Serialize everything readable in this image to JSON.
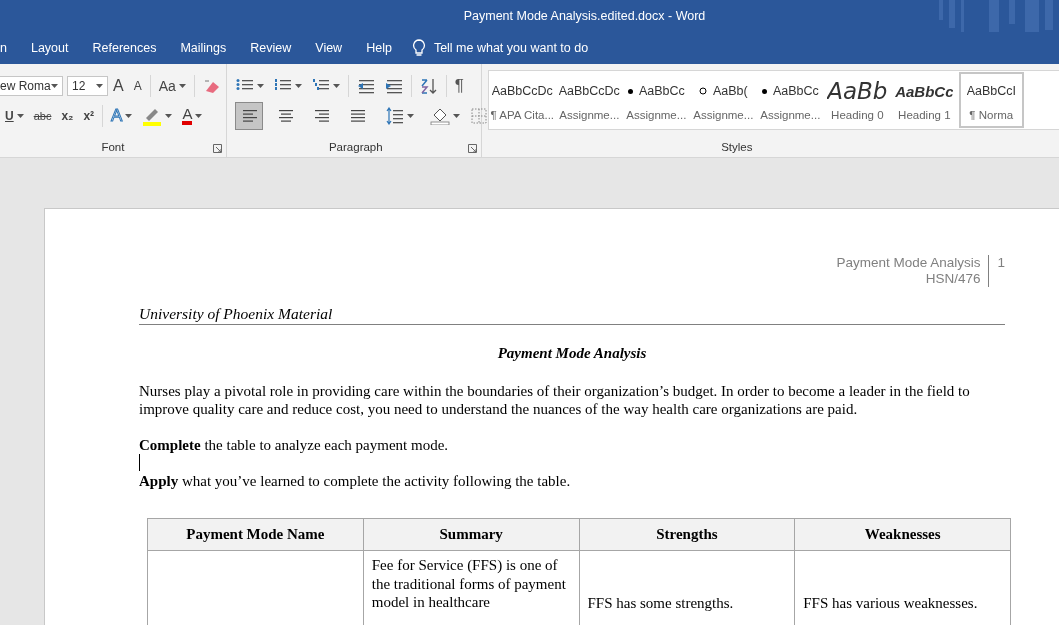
{
  "window": {
    "title": "Payment Mode Analysis.edited.docx  -  Word"
  },
  "tabs": [
    {
      "label": "n"
    },
    {
      "label": "Layout"
    },
    {
      "label": "References"
    },
    {
      "label": "Mailings"
    },
    {
      "label": "Review"
    },
    {
      "label": "View"
    },
    {
      "label": "Help"
    }
  ],
  "tell_me": {
    "placeholder": "Tell me what you want to do"
  },
  "font_group": {
    "label": "Font",
    "font_name": "ew Roma",
    "font_size": "12",
    "row1": [
      {
        "kind": "grow",
        "text": "A"
      },
      {
        "kind": "shrink",
        "text": "A"
      },
      {
        "kind": "case",
        "text": "Aa"
      },
      {
        "kind": "clear"
      }
    ],
    "row2": [
      {
        "kind": "underline",
        "text": "U"
      },
      {
        "kind": "strike",
        "text": "abc"
      },
      {
        "kind": "sub",
        "text": "x₂"
      },
      {
        "kind": "sup",
        "text": "x²"
      },
      {
        "kind": "effects",
        "text": "A"
      },
      {
        "kind": "highlight",
        "color": "#ffff00"
      },
      {
        "kind": "fontcolor",
        "text": "A",
        "color": "#e00000"
      }
    ]
  },
  "paragraph_group": {
    "label": "Paragraph",
    "row1": [
      {
        "kind": "bullets"
      },
      {
        "kind": "numbering"
      },
      {
        "kind": "multilevel"
      },
      {
        "kind": "outdent"
      },
      {
        "kind": "indent"
      },
      {
        "kind": "sort"
      },
      {
        "kind": "marks",
        "text": "¶"
      }
    ],
    "row2": [
      {
        "kind": "align-left",
        "selected": true
      },
      {
        "kind": "align-center",
        "selected": false
      },
      {
        "kind": "align-right",
        "selected": false
      },
      {
        "kind": "justify",
        "selected": false
      },
      {
        "kind": "spacing"
      },
      {
        "kind": "shading"
      },
      {
        "kind": "borders"
      }
    ]
  },
  "styles_group": {
    "label": "Styles",
    "items": [
      {
        "preview": "AaBbCcDc",
        "name": "¶ APA Cita...",
        "kind": "plain",
        "selected": false
      },
      {
        "preview": "AaBbCcDc",
        "name": "Assignme...",
        "kind": "plain",
        "selected": false
      },
      {
        "preview": "AaBbCc",
        "name": "Assignme...",
        "kind": "bullet",
        "selected": false
      },
      {
        "preview": "AaBb(",
        "name": "Assignme...",
        "kind": "circle",
        "selected": false
      },
      {
        "preview": "AaBbCc",
        "name": "Assignme...",
        "kind": "bullet",
        "selected": false
      },
      {
        "preview": "AaBb",
        "name": "Heading 0",
        "kind": "heading0",
        "selected": false
      },
      {
        "preview": "AaBbCc",
        "name": "Heading 1",
        "kind": "heading1",
        "selected": false
      },
      {
        "preview": "AaBbCcI",
        "name": "¶ Norma",
        "kind": "plain",
        "selected": true
      }
    ]
  },
  "document": {
    "header": {
      "title": "Payment Mode Analysis",
      "code": "HSN/476",
      "page": "1"
    },
    "material": "University of Phoenix Material",
    "heading": "Payment Mode Analysis",
    "paragraphs": [
      {
        "kind": "text",
        "text": "Nurses play a pivotal role in providing care within the boundaries of their organization’s budget. In order to become a leader in the field to improve quality care and reduce cost, you need to understand the nuances of the way health care organizations are paid."
      },
      {
        "kind": "text",
        "text": "**Complete** the table to analyze each payment mode."
      },
      {
        "kind": "cursor"
      },
      {
        "kind": "text",
        "text": "**Apply** what you’ve learned to complete the activity following the table."
      }
    ],
    "table": {
      "columns": [
        "Payment Mode Name",
        "Summary",
        "Strengths",
        "Weaknesses"
      ],
      "rows": [
        [
          "",
          "Fee for Service (FFS) is one of the traditional forms of payment model in healthcare",
          "FFS has some strengths.",
          "FFS has various weaknesses."
        ]
      ]
    }
  }
}
